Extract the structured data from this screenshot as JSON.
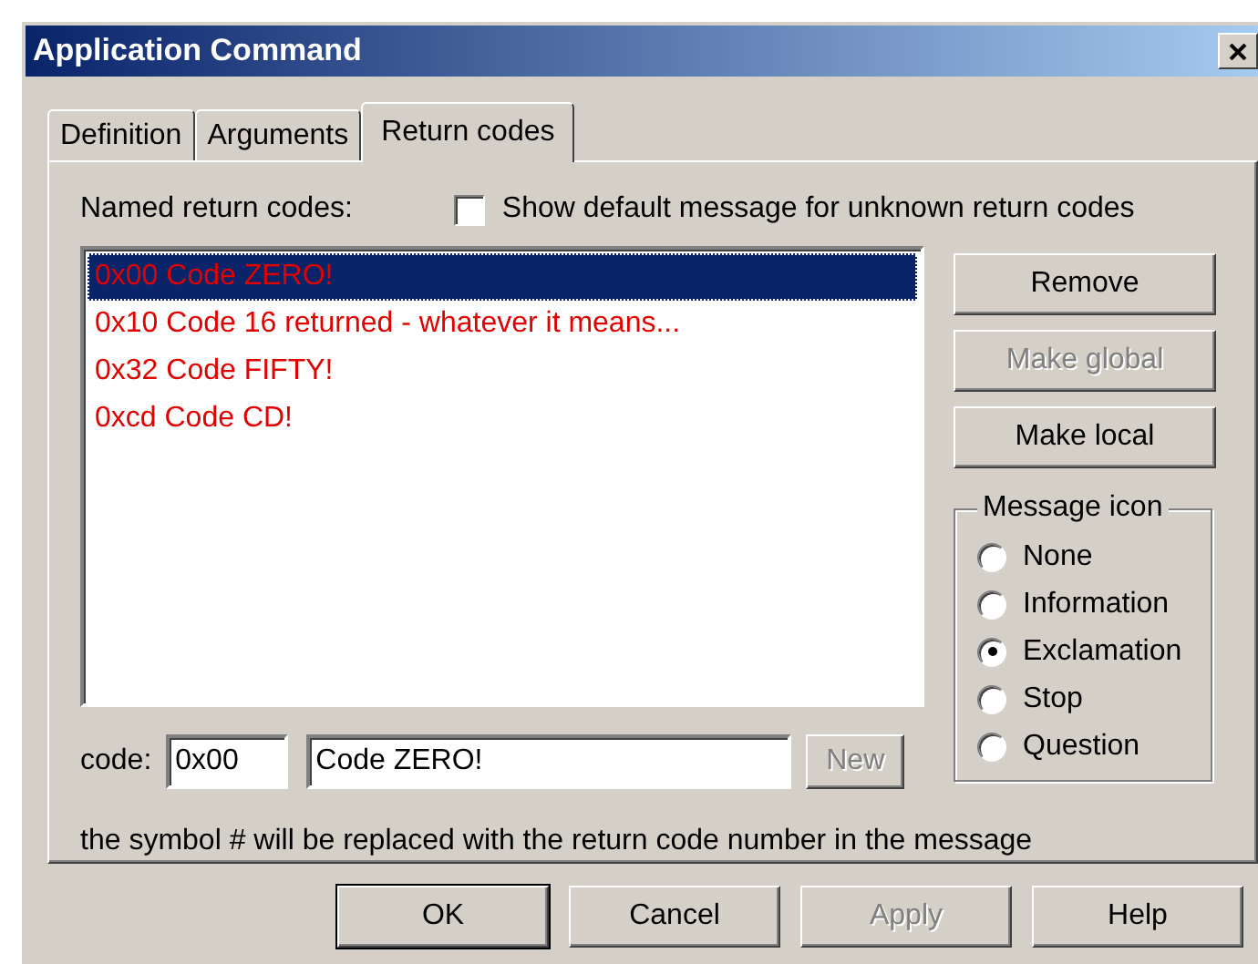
{
  "window": {
    "title": "Application Command"
  },
  "tabs": [
    {
      "label": "Definition",
      "selected": false
    },
    {
      "label": "Arguments",
      "selected": false
    },
    {
      "label": "Return codes",
      "selected": true
    }
  ],
  "list_label": "Named return codes:",
  "show_default": {
    "label": "Show default message for unknown return codes",
    "checked": false
  },
  "return_codes": [
    {
      "text": "0x00 Code ZERO!",
      "selected": true
    },
    {
      "text": "0x10 Code 16 returned - whatever it means...",
      "selected": false
    },
    {
      "text": "0x32 Code FIFTY!",
      "selected": false
    },
    {
      "text": "0xcd Code CD!",
      "selected": false
    }
  ],
  "side_buttons": [
    {
      "label": "Remove",
      "disabled": false
    },
    {
      "label": "Make global",
      "disabled": true
    },
    {
      "label": "Make local",
      "disabled": false
    }
  ],
  "message_icon": {
    "label": "Message icon",
    "options": [
      {
        "label": "None",
        "selected": false
      },
      {
        "label": "Information",
        "selected": false
      },
      {
        "label": "Exclamation",
        "selected": true
      },
      {
        "label": "Stop",
        "selected": false
      },
      {
        "label": "Question",
        "selected": false
      }
    ]
  },
  "code": {
    "label": "code:",
    "value": "0x00"
  },
  "message": {
    "value": "Code ZERO!"
  },
  "new_button": {
    "label": "New",
    "disabled": true
  },
  "hint": "the symbol # will be replaced with the return code number in the message",
  "dialog_buttons": [
    {
      "label": "OK",
      "disabled": false,
      "default": true
    },
    {
      "label": "Cancel",
      "disabled": false,
      "default": false
    },
    {
      "label": "Apply",
      "disabled": true,
      "default": false
    },
    {
      "label": "Help",
      "disabled": false,
      "default": false
    }
  ]
}
